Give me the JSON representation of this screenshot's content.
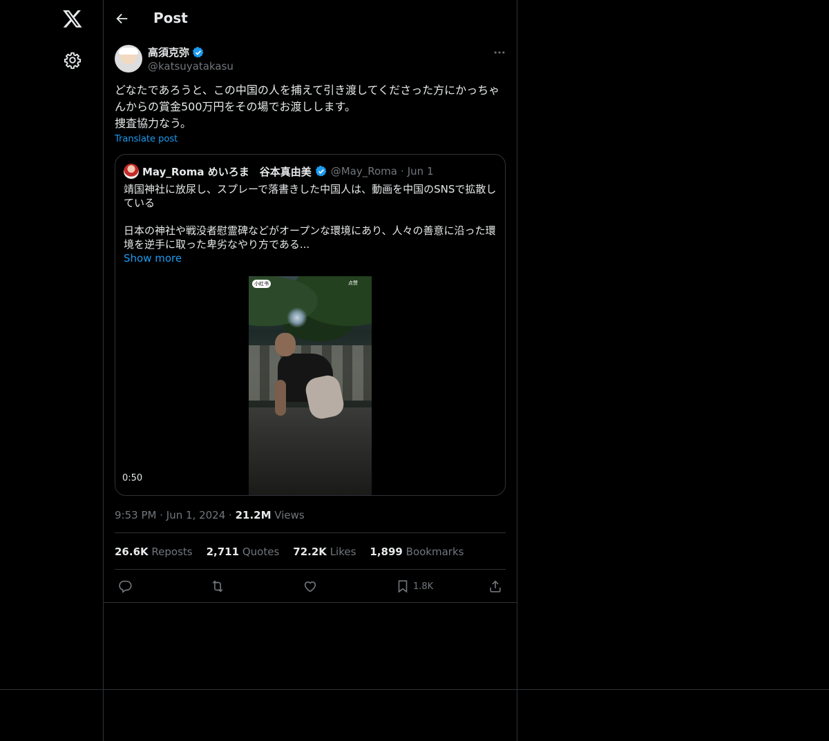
{
  "header": {
    "title": "Post"
  },
  "tweet": {
    "author_name": "高須克弥",
    "handle": "@katsuyatakasu",
    "text": "どなたであろうと、この中国の人を捕えて引き渡してくださった方にかっちゃんからの賞金500万円をその場でお渡しします。\n捜査協力なう。",
    "translate_label": "Translate post",
    "time": "9:53 PM",
    "date": "Jun 1, 2024",
    "views_count": "21.2M",
    "views_label": "Views"
  },
  "quote": {
    "author_name": "May_Roma めいろま　谷本真由美",
    "handle": "@May_Roma",
    "date": "Jun 1",
    "text": "靖国神社に放尿し、スプレーで落書きした中国人は、動画を中国のSNSで拡散している\n\n日本の神社や戦没者慰霊碑などがオープンな環境にあり、人々の善意に沿った環境を逆手に取った卑劣なやり方である...",
    "show_more": "Show more",
    "video_duration": "0:50",
    "video_tag_left": "小红书",
    "video_tag_right": "点赞"
  },
  "stats": {
    "reposts_count": "26.6K",
    "reposts_label": "Reposts",
    "quotes_count": "2,711",
    "quotes_label": "Quotes",
    "likes_count": "72.2K",
    "likes_label": "Likes",
    "bookmarks_count": "1,899",
    "bookmarks_label": "Bookmarks"
  },
  "actions": {
    "bookmark_count": "1.8K"
  },
  "icons": [
    "x-logo-icon",
    "settings-icon",
    "back-arrow-icon",
    "verified-icon",
    "more-icon",
    "reply-icon",
    "repost-icon",
    "like-icon",
    "bookmark-icon",
    "share-icon"
  ],
  "colors": {
    "background": "#000000",
    "text": "#e7e9ea",
    "muted": "#71767b",
    "accent": "#1d9bf0",
    "border": "#2f3336"
  }
}
